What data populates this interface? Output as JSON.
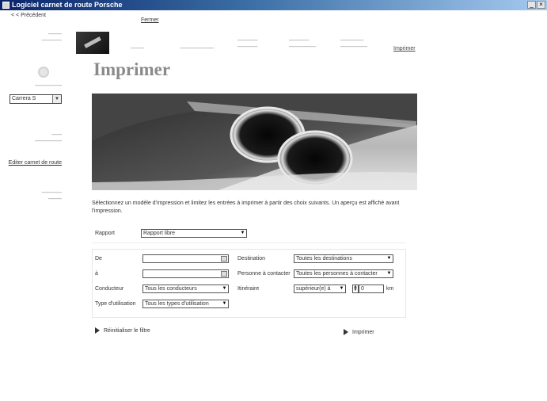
{
  "window": {
    "title": "Logiciel carnet de route Porsche",
    "controls": [
      "_",
      "×"
    ]
  },
  "topnav": {
    "back": "< < Précédent",
    "close": "Fermer"
  },
  "sidebar": {
    "model_select": "Carrera S",
    "link": "Editer carnet de route"
  },
  "tabs": {
    "active": "Imprimer"
  },
  "page": {
    "title": "Imprimer"
  },
  "intro": "Sélectionnez un modèle d'impression et limitez les entrées à imprimer à partir des choix suivants. Un aperçu est affiché avant l'impression.",
  "report": {
    "label": "Rapport",
    "value": "Rapport libre"
  },
  "filters": {
    "from_label": "De",
    "to_label": "à",
    "driver_label": "Conducteur",
    "driver_value": "Tous les conducteurs",
    "usage_label": "Type d'utilisation",
    "usage_value": "Tous les types d'utilisation",
    "destination_label": "Destination",
    "destination_value": "Toutes les destinations",
    "contact_label": "Personne à contacter",
    "contact_value": "Toutes les personnes à contacter",
    "route_label": "Itinéraire",
    "route_op": "supérieur(e) à",
    "route_value": "0",
    "route_unit": "km"
  },
  "actions": {
    "reset": "Réinitialiser le filtre",
    "print": "Imprimer"
  }
}
